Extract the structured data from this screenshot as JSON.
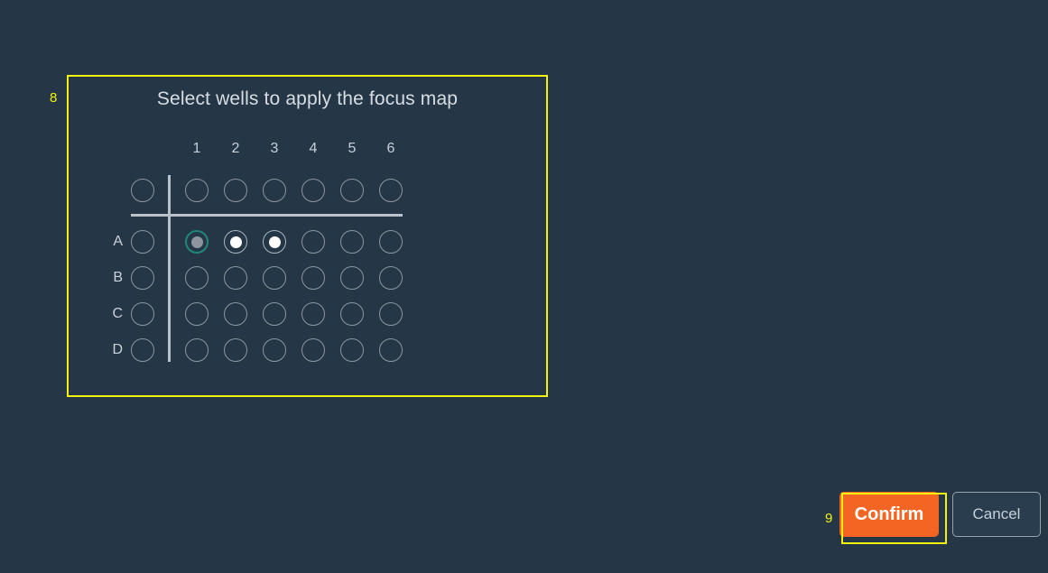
{
  "theme": {
    "background": "#253746",
    "panel_text": "#d7dde3",
    "well_outline": "#aab4be",
    "well_fill_selected": "#ffffff",
    "well_focus_ring": "#21867a",
    "well_focus_fill": "#8d969e",
    "divider": "#b9c2ca",
    "annotation": "#f2f20d",
    "confirm_orange": "#f26522",
    "cancel_border": "#97a3ae"
  },
  "dialog": {
    "title": "Select wells to apply the focus map"
  },
  "plate": {
    "column_labels": [
      "1",
      "2",
      "3",
      "4",
      "5",
      "6"
    ],
    "row_labels": [
      "A",
      "B",
      "C",
      "D"
    ],
    "select_all_column_label": "",
    "select_all_row_label": "",
    "wells": [
      {
        "row": "A",
        "col": "1",
        "state": "focused"
      },
      {
        "row": "A",
        "col": "2",
        "state": "selected"
      },
      {
        "row": "A",
        "col": "3",
        "state": "selected"
      },
      {
        "row": "A",
        "col": "4",
        "state": "empty"
      },
      {
        "row": "A",
        "col": "5",
        "state": "empty"
      },
      {
        "row": "A",
        "col": "6",
        "state": "empty"
      },
      {
        "row": "B",
        "col": "1",
        "state": "empty"
      },
      {
        "row": "B",
        "col": "2",
        "state": "empty"
      },
      {
        "row": "B",
        "col": "3",
        "state": "empty"
      },
      {
        "row": "B",
        "col": "4",
        "state": "empty"
      },
      {
        "row": "B",
        "col": "5",
        "state": "empty"
      },
      {
        "row": "B",
        "col": "6",
        "state": "empty"
      },
      {
        "row": "C",
        "col": "1",
        "state": "empty"
      },
      {
        "row": "C",
        "col": "2",
        "state": "empty"
      },
      {
        "row": "C",
        "col": "3",
        "state": "empty"
      },
      {
        "row": "C",
        "col": "4",
        "state": "empty"
      },
      {
        "row": "C",
        "col": "5",
        "state": "empty"
      },
      {
        "row": "C",
        "col": "6",
        "state": "empty"
      },
      {
        "row": "D",
        "col": "1",
        "state": "empty"
      },
      {
        "row": "D",
        "col": "2",
        "state": "empty"
      },
      {
        "row": "D",
        "col": "3",
        "state": "empty"
      },
      {
        "row": "D",
        "col": "4",
        "state": "empty"
      },
      {
        "row": "D",
        "col": "5",
        "state": "empty"
      },
      {
        "row": "D",
        "col": "6",
        "state": "empty"
      }
    ],
    "select_all_header_wells": [
      "1",
      "2",
      "3",
      "4",
      "5",
      "6"
    ],
    "select_all_row_wells": [
      "A",
      "B",
      "C",
      "D"
    ],
    "selected_count": "3"
  },
  "footer": {
    "confirm_label": "Confirm",
    "cancel_label": "Cancel"
  },
  "annotations": [
    {
      "id": "8",
      "target": "well-selection-dialog"
    },
    {
      "id": "9",
      "target": "confirm-button"
    }
  ]
}
